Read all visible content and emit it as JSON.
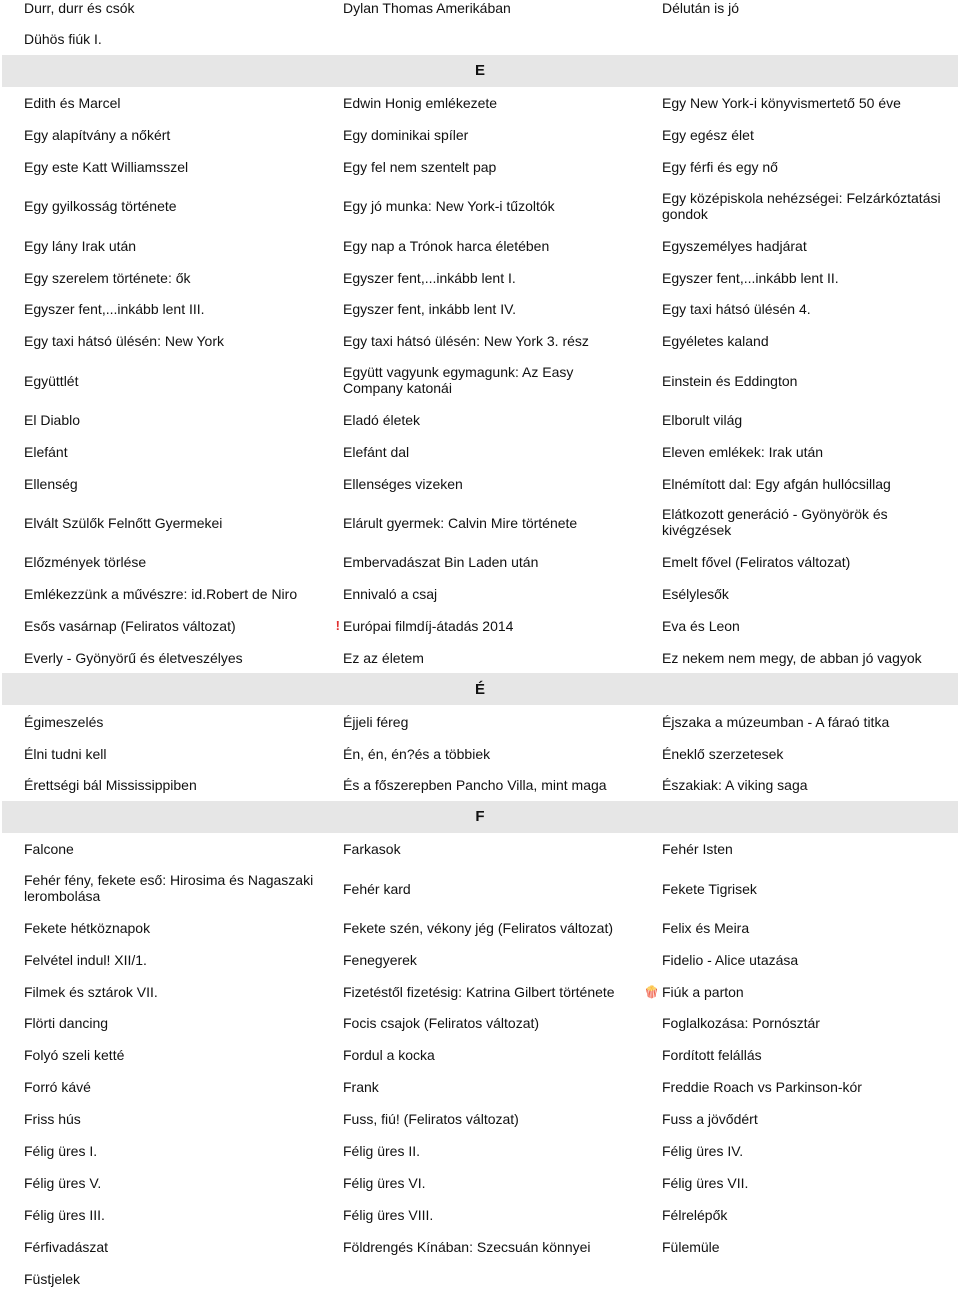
{
  "sections": [
    {
      "header": "",
      "rows": [
        [
          {
            "text": "Durr, durr és csók"
          },
          {
            "text": "Dylan Thomas Amerikában"
          },
          {
            "text": "Délután is jó"
          }
        ],
        [
          {
            "text": "Dühös fiúk I."
          }
        ]
      ]
    },
    {
      "header": "E",
      "rows": [
        [
          {
            "text": "Edith és Marcel"
          },
          {
            "text": "Edwin Honig emlékezete"
          },
          {
            "text": "Egy New York-i könyvismertető 50 éve"
          }
        ],
        [
          {
            "text": "Egy alapítvány a nőkért"
          },
          {
            "text": "Egy dominikai spíler"
          },
          {
            "text": "Egy egész élet"
          }
        ],
        [
          {
            "text": "Egy este Katt Williamsszel"
          },
          {
            "text": "Egy fel nem szentelt pap"
          },
          {
            "text": "Egy férfi és egy nő"
          }
        ],
        [
          {
            "text": "Egy gyilkosság története"
          },
          {
            "text": "Egy jó munka: New York-i tűzoltók"
          },
          {
            "text": "Egy középiskola nehézségei: Felzárkóztatási gondok"
          }
        ],
        [
          {
            "text": "Egy lány Irak után"
          },
          {
            "text": "Egy nap a Trónok harca életében"
          },
          {
            "text": "Egyszemélyes hadjárat"
          }
        ],
        [
          {
            "text": "Egy szerelem története: ők"
          },
          {
            "text": "Egyszer fent,...inkább lent I."
          },
          {
            "text": "Egyszer fent,...inkább lent II."
          }
        ],
        [
          {
            "text": "Egyszer fent,...inkább lent III."
          },
          {
            "text": "Egyszer fent, inkább lent IV."
          },
          {
            "text": "Egy taxi hátsó ülésén 4."
          }
        ],
        [
          {
            "text": "Egy taxi hátsó ülésén: New York"
          },
          {
            "text": "Egy taxi hátsó ülésén: New York 3. rész"
          },
          {
            "text": "Egyéletes kaland"
          }
        ],
        [
          {
            "text": "Együttlét"
          },
          {
            "text": "Együtt vagyunk egymagunk: Az Easy Company katonái"
          },
          {
            "text": "Einstein és Eddington"
          }
        ],
        [
          {
            "text": "El Diablo"
          },
          {
            "text": "Eladó életek"
          },
          {
            "text": "Elborult világ"
          }
        ],
        [
          {
            "text": "Elefánt"
          },
          {
            "text": "Elefánt dal"
          },
          {
            "text": "Eleven emlékek: Irak után"
          }
        ],
        [
          {
            "text": "Ellenség"
          },
          {
            "text": "Ellenséges vizeken"
          },
          {
            "text": "Elnémított dal: Egy afgán hullócsillag"
          }
        ],
        [
          {
            "text": "Elvált Szülők Felnőtt Gyermekei"
          },
          {
            "text": "Elárult gyermek: Calvin Mire története"
          },
          {
            "text": "Elátkozott generáció - Gyönyörök és kivégzések"
          }
        ],
        [
          {
            "text": "Előzmények törlése"
          },
          {
            "text": "Embervadászat Bin Laden után"
          },
          {
            "text": "Emelt fővel (Feliratos változat)"
          }
        ],
        [
          {
            "text": "Emlékezzünk a művészre: id.Robert de Niro"
          },
          {
            "text": "Ennivaló a csaj"
          },
          {
            "text": "Esélylesők"
          }
        ],
        [
          {
            "text": "Esős vasárnap (Feliratos változat)"
          },
          {
            "text": "Európai filmdíj-átadás 2014",
            "icon": "exclamation-icon"
          },
          {
            "text": "Eva és Leon"
          }
        ],
        [
          {
            "text": "Everly - Gyönyörű és életveszélyes"
          },
          {
            "text": "Ez az életem"
          },
          {
            "text": "Ez nekem nem megy, de abban jó vagyok"
          }
        ]
      ]
    },
    {
      "header": "É",
      "rows": [
        [
          {
            "text": "Égimeszelés"
          },
          {
            "text": "Éjjeli féreg"
          },
          {
            "text": "Éjszaka a múzeumban - A fáraó titka"
          }
        ],
        [
          {
            "text": "Élni tudni kell"
          },
          {
            "text": "Én, én, én?és a többiek"
          },
          {
            "text": "Éneklő szerzetesek"
          }
        ],
        [
          {
            "text": "Érettségi bál Mississippiben"
          },
          {
            "text": "És a főszerepben Pancho Villa, mint maga"
          },
          {
            "text": "Északiak: A viking saga"
          }
        ]
      ]
    },
    {
      "header": "F",
      "rows": [
        [
          {
            "text": "Falcone"
          },
          {
            "text": "Farkasok"
          },
          {
            "text": "Fehér Isten"
          }
        ],
        [
          {
            "text": "Fehér fény, fekete eső: Hirosima és Nagaszaki lerombolása"
          },
          {
            "text": "Fehér kard"
          },
          {
            "text": "Fekete Tigrisek"
          }
        ],
        [
          {
            "text": "Fekete hétköznapok"
          },
          {
            "text": "Fekete szén, vékony jég (Feliratos változat)"
          },
          {
            "text": "Felix és Meira"
          }
        ],
        [
          {
            "text": "Felvétel indul! XII/1."
          },
          {
            "text": "Fenegyerek"
          },
          {
            "text": "Fidelio - Alice utazása"
          }
        ],
        [
          {
            "text": "Filmek és sztárok VII."
          },
          {
            "text": "Fizetéstől fizetésig: Katrina Gilbert története"
          },
          {
            "text": "Fiúk a parton",
            "icon": "popcorn-icon"
          }
        ],
        [
          {
            "text": "Flörti dancing"
          },
          {
            "text": "Focis csajok (Feliratos változat)"
          },
          {
            "text": "Foglalkozása: Pornósztár"
          }
        ],
        [
          {
            "text": "Folyó szeli ketté"
          },
          {
            "text": "Fordul a kocka"
          },
          {
            "text": "Fordított felállás"
          }
        ],
        [
          {
            "text": "Forró kávé"
          },
          {
            "text": "Frank"
          },
          {
            "text": "Freddie Roach vs Parkinson-kór"
          }
        ],
        [
          {
            "text": "Friss hús"
          },
          {
            "text": "Fuss, fiú! (Feliratos változat)"
          },
          {
            "text": "Fuss a jövődért"
          }
        ],
        [
          {
            "text": "Félig üres I."
          },
          {
            "text": "Félig üres II."
          },
          {
            "text": "Félig üres IV."
          }
        ],
        [
          {
            "text": "Félig üres V."
          },
          {
            "text": "Félig üres VI."
          },
          {
            "text": "Félig üres VII."
          }
        ],
        [
          {
            "text": "Félig üres III."
          },
          {
            "text": "Félig üres VIII."
          },
          {
            "text": "Félrelépők"
          }
        ],
        [
          {
            "text": "Férfivadászat"
          },
          {
            "text": "Földrengés Kínában: Szecsuán könnyei"
          },
          {
            "text": "Fülemüle"
          }
        ],
        [
          {
            "text": "Füstjelek"
          }
        ]
      ]
    }
  ]
}
